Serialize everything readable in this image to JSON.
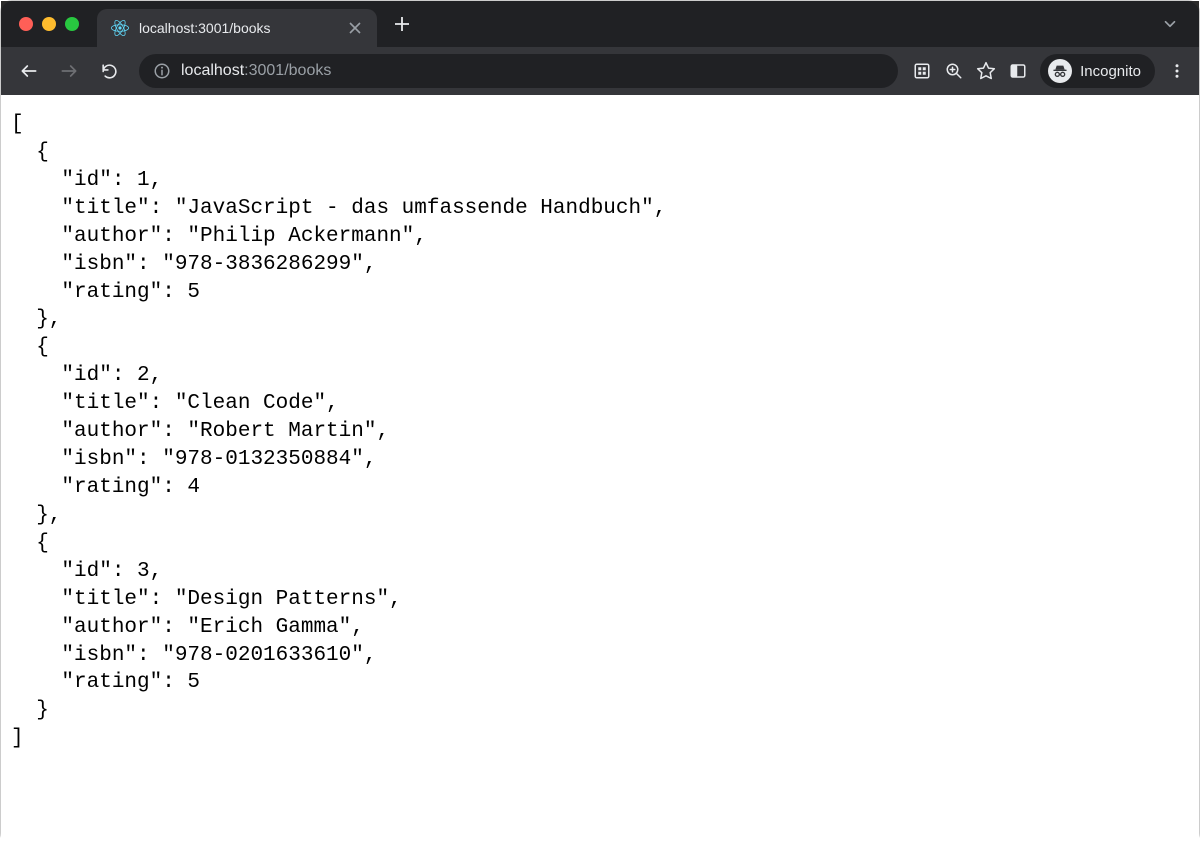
{
  "tab": {
    "title": "localhost:3001/books"
  },
  "url": {
    "host": "localhost",
    "port_path": ":3001/books"
  },
  "incognito_label": "Incognito",
  "books": [
    {
      "id": 1,
      "title": "JavaScript - das umfassende Handbuch",
      "author": "Philip Ackermann",
      "isbn": "978-3836286299",
      "rating": 5
    },
    {
      "id": 2,
      "title": "Clean Code",
      "author": "Robert Martin",
      "isbn": "978-0132350884",
      "rating": 4
    },
    {
      "id": 3,
      "title": "Design Patterns",
      "author": "Erich Gamma",
      "isbn": "978-0201633610",
      "rating": 5
    }
  ]
}
